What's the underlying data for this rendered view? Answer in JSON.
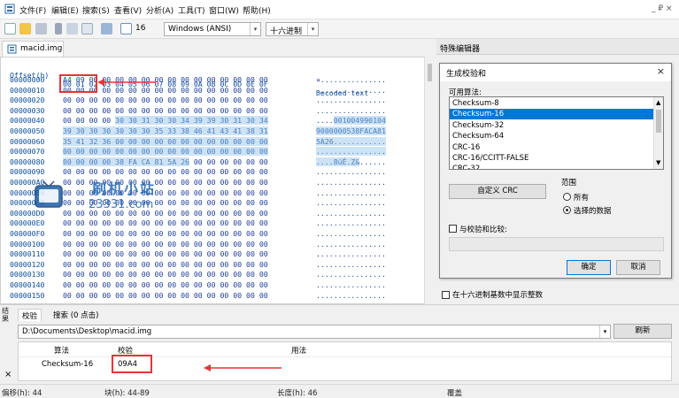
{
  "menubar": {
    "items": [
      "文件(F)",
      "编辑(E)",
      "搜索(S)",
      "查看(V)",
      "分析(A)",
      "工具(T)",
      "窗口(W)",
      "帮助(H)"
    ],
    "window_controls": "_ ₽ ×"
  },
  "toolbar": {
    "bytes_per_row": "16",
    "encoding": "Windows (ANSI)",
    "radix": "十六进制"
  },
  "document": {
    "tab_title": "macid.img",
    "header_offset": "Offset(h)",
    "header_columns": "00 01 02 03 04 05 06 07 08 09 0A 0B 0C 0D 0E 0F",
    "header_decoded": "Decoded text",
    "rows": [
      {
        "offset": "00000000",
        "hex": "A4 09 00 00 00 00 00 00 00 00 00 00 00 00 00 00",
        "text": "¤..............."
      },
      {
        "offset": "00000010",
        "hex": "00 00 00 00 00 00 00 00 00 00 00 00 00 00 00 00",
        "text": "................"
      },
      {
        "offset": "00000020",
        "hex": "00 00 00 00 00 00 00 00 00 00 00 00 00 00 00 00",
        "text": "................"
      },
      {
        "offset": "00000030",
        "hex": "00 00 00 00 00 00 00 00 00 00 00 00 00 00 00 00",
        "text": "................"
      },
      {
        "offset": "00000040",
        "hex": "00 00 00 00 30 30 31 30 30 34 39 39 30 31 30 34",
        "text": "....001004990104"
      },
      {
        "offset": "00000050",
        "hex": "39 30 30 30 30 30 30 35 33 38 46 41 43 41 38 31",
        "text": "9000000538FACA81"
      },
      {
        "offset": "00000060",
        "hex": "35 41 32 36 00 00 00 00 00 00 00 00 00 00 00 00",
        "text": "5A26............"
      },
      {
        "offset": "00000070",
        "hex": "00 00 00 00 00 00 00 00 00 00 00 00 00 00 00 00",
        "text": "................"
      },
      {
        "offset": "00000080",
        "hex": "00 00 00 00 38 FA CA 81 5A 26 00 00 00 00 00 00",
        "text": "....8úÊ.Z&......"
      },
      {
        "offset": "00000090",
        "hex": "00 00 00 00 00 00 00 00 00 00 00 00 00 00 00 00",
        "text": "................"
      },
      {
        "offset": "000000A0",
        "hex": "00 00 00 00 00 00 00 00 00 00 00 00 00 00 00 00",
        "text": "................"
      },
      {
        "offset": "000000B0",
        "hex": "00 00 00 00 00 00 00 00 00 00 00 00 00 00 00 00",
        "text": "................"
      },
      {
        "offset": "000000C0",
        "hex": "00 00 00 00 00 00 00 00 00 00 00 00 00 00 00 00",
        "text": "................"
      },
      {
        "offset": "000000D0",
        "hex": "00 00 00 00 00 00 00 00 00 00 00 00 00 00 00 00",
        "text": "................"
      },
      {
        "offset": "000000E0",
        "hex": "00 00 00 00 00 00 00 00 00 00 00 00 00 00 00 00",
        "text": "................"
      },
      {
        "offset": "000000F0",
        "hex": "00 00 00 00 00 00 00 00 00 00 00 00 00 00 00 00",
        "text": "................"
      },
      {
        "offset": "00000100",
        "hex": "00 00 00 00 00 00 00 00 00 00 00 00 00 00 00 00",
        "text": "................"
      },
      {
        "offset": "00000110",
        "hex": "00 00 00 00 00 00 00 00 00 00 00 00 00 00 00 00",
        "text": "................"
      },
      {
        "offset": "00000120",
        "hex": "00 00 00 00 00 00 00 00 00 00 00 00 00 00 00 00",
        "text": "................"
      },
      {
        "offset": "00000130",
        "hex": "00 00 00 00 00 00 00 00 00 00 00 00 00 00 00 00",
        "text": "................"
      },
      {
        "offset": "00000140",
        "hex": "00 00 00 00 00 00 00 00 00 00 00 00 00 00 00 00",
        "text": "................"
      },
      {
        "offset": "00000150",
        "hex": "00 00 00 00 00 00 00 00 00 00 00 00 00 00 00 00",
        "text": "................"
      }
    ]
  },
  "special_editor": {
    "title": "特殊编辑器",
    "show_decimal_label": "在十六进制基数中显示整数"
  },
  "checksum_dialog": {
    "title": "生成校验和",
    "close": "×",
    "algorithms_label": "可用算法:",
    "algorithms": [
      "Checksum-8",
      "Checksum-16",
      "Checksum-32",
      "Checksum-64",
      "CRC-16",
      "CRC-16/CCITT-FALSE",
      "CRC-32"
    ],
    "selected_index": 1,
    "custom_crc_button": "自定义 CRC",
    "range_label": "范围",
    "range_all": "所有",
    "range_selected": "选择的数据",
    "compare_label": "与校验和比较:",
    "ok_button": "确定",
    "cancel_button": "取消"
  },
  "results": {
    "panel_vertical_label": "结果",
    "tabs": [
      "校验",
      "搜索 (0 点击)"
    ],
    "path": "D:\\Documents\\Desktop\\macid.img",
    "refresh_button": "刷新",
    "columns": [
      "算法",
      "校验",
      "用法"
    ],
    "rows": [
      {
        "algorithm": "Checksum-16",
        "checksum": "09A4",
        "usage": ""
      }
    ],
    "close_mark": "×"
  },
  "statusbar": {
    "offset": "偏移(h): 44",
    "block": "块(h): 44-89",
    "length": "长度(h): 46",
    "mode": "覆盖"
  },
  "watermark": {
    "title": "刷机小站",
    "url": "23331.com"
  },
  "colors": {
    "selection_blue": "#0078d7",
    "hex_blue": "#1f3f9c",
    "highlight": "#cde3f5",
    "annotation_red": "#e53535"
  }
}
